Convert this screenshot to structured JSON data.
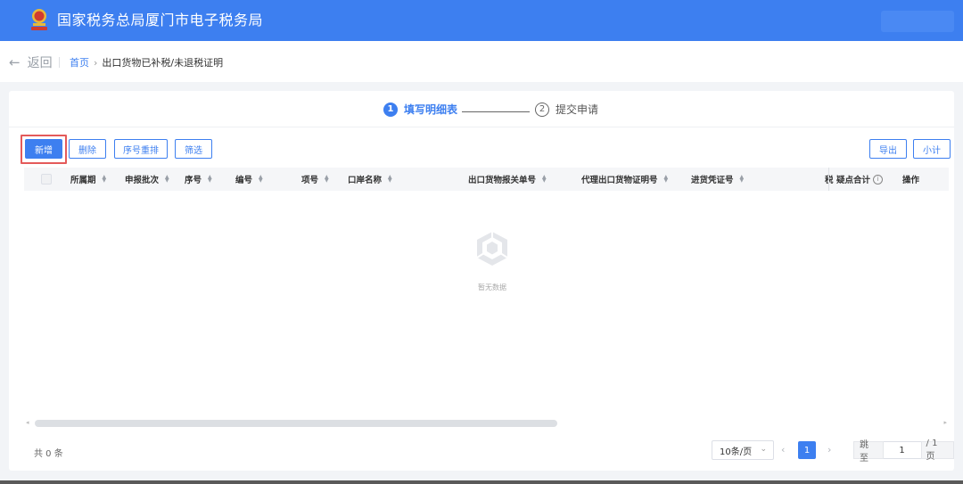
{
  "header": {
    "title": "国家税务总局厦门市电子税务局"
  },
  "subnav": {
    "back_label": "返回",
    "breadcrumb_home": "首页",
    "breadcrumb_sep": "›",
    "breadcrumb_current": "出口货物已补税/未退税证明"
  },
  "steps": [
    {
      "number": "1",
      "label": "填写明细表",
      "active": true
    },
    {
      "number": "2",
      "label": "提交申请",
      "active": false
    }
  ],
  "toolbar": {
    "add": "新增",
    "delete": "删除",
    "reorder": "序号重排",
    "filter": "筛选",
    "export": "导出",
    "subtotal": "小计"
  },
  "table": {
    "columns": [
      "所属期",
      "申报批次",
      "序号",
      "编号",
      "项号",
      "口岸名称",
      "出口货物报关单号",
      "代理出口货物证明号",
      "进货凭证号",
      "税",
      "疑点合计",
      "操作"
    ],
    "empty_text": "暂无数据"
  },
  "footer": {
    "total": "共 0 条",
    "page_size": "10条/页",
    "current_page": "1",
    "jump_label": "跳至",
    "jump_value": "1",
    "total_pages": "/ 1 页"
  },
  "colors": {
    "brand": "#3d7ff0",
    "highlight": "#e45a5a"
  }
}
